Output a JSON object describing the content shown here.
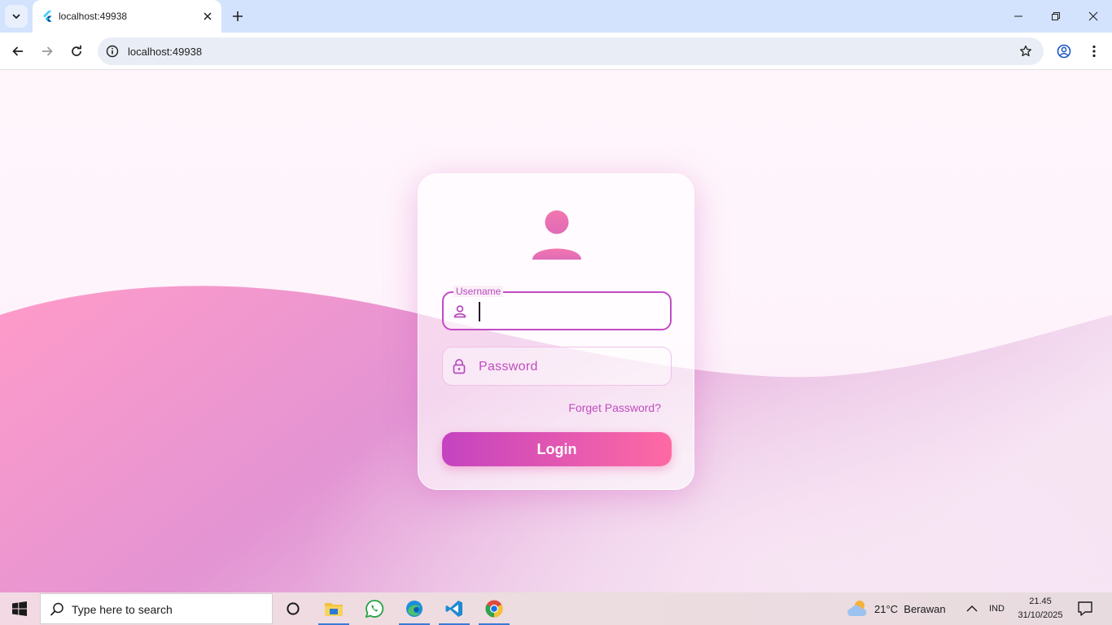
{
  "browser": {
    "tab_title": "localhost:49938",
    "url": "localhost:49938"
  },
  "login": {
    "username_label": "Username",
    "password_placeholder": "Password",
    "forget_password": "Forget Password?",
    "login_button": "Login"
  },
  "taskbar": {
    "search_placeholder": "Type here to search",
    "weather_temp": "21°C",
    "weather_desc": "Berawan",
    "language": "IND",
    "time": "21.45",
    "date": "31/10/2025"
  },
  "colors": {
    "accent": "#c24bc4",
    "button_start": "#c443c0",
    "button_end": "#ff6aa3",
    "avatar_pink": "#f06aa8"
  },
  "icons": [
    "flutter-favicon",
    "back-arrow-icon",
    "forward-arrow-icon",
    "reload-icon",
    "site-info-icon",
    "bookmark-star-icon",
    "profile-icon",
    "menu-kebab-icon",
    "user-avatar-icon",
    "person-outline-icon",
    "lock-icon",
    "windows-start-icon",
    "search-icon",
    "cortana-icon",
    "file-explorer-icon",
    "whatsapp-icon",
    "edge-icon",
    "vscode-icon",
    "chrome-icon",
    "weather-cloud-icon",
    "notification-icon"
  ]
}
